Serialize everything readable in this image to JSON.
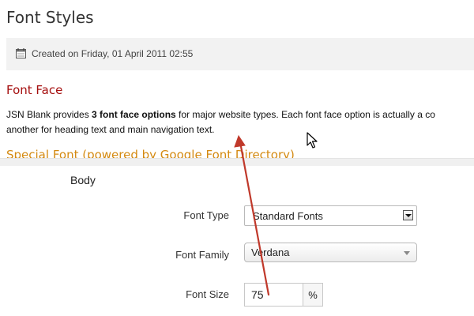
{
  "article": {
    "title": "Font Styles",
    "created": "Created on Friday, 01 April 2011 02:55",
    "section_title": "Font Face",
    "paragraph": {
      "part1": "JSN Blank provides ",
      "bold": "3 font face options",
      "part2": " for major website types. Each font face option is actually a co",
      "line2": "another for heading text and main navigation text."
    },
    "subsection_title": "Special Font (powered by Google Font Directory)"
  },
  "settings": {
    "group_label": "Body",
    "font_type": {
      "label": "Font Type",
      "value": "Standard Fonts"
    },
    "font_family": {
      "label": "Font Family",
      "value": "Verdana"
    },
    "font_size": {
      "label": "Font Size",
      "value": "75",
      "unit": "%"
    }
  },
  "icons": {
    "calendar": "calendar-icon",
    "cursor": "mouse-pointer-icon",
    "select_arrow": "chevron-down-icon"
  },
  "colors": {
    "section_title": "#a50f0f",
    "subsection_title": "#d48a12",
    "annotation_arrow": "#c0392b",
    "meta_bar_bg": "#f2f2f2"
  }
}
